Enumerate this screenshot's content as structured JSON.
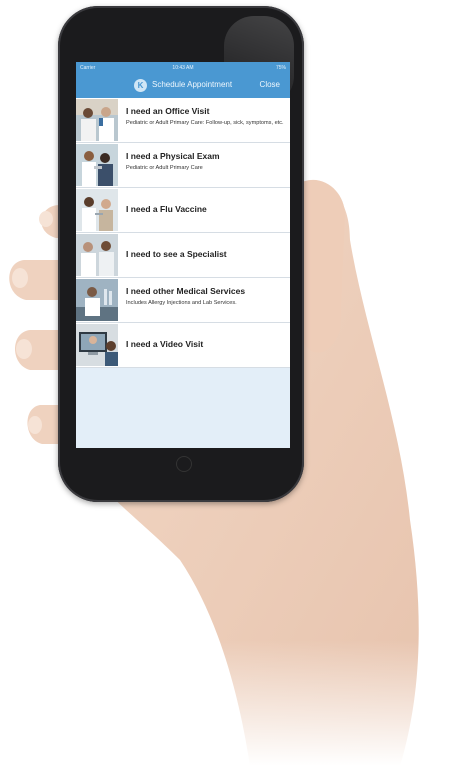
{
  "status_bar": {
    "carrier": "Carrier",
    "time": "10:43 AM",
    "battery": "75%"
  },
  "nav": {
    "title": "Schedule Appointment",
    "close_label": "Close",
    "logo_letter": "K"
  },
  "options": [
    {
      "title": "I need an Office Visit",
      "subtitle": "Pediatric or Adult Primary Care: Follow-up, sick, symptoms, etc."
    },
    {
      "title": "I need a Physical Exam",
      "subtitle": "Pediatric or Adult Primary Care"
    },
    {
      "title": "I need a Flu Vaccine",
      "subtitle": ""
    },
    {
      "title": "I need to see a Specialist",
      "subtitle": ""
    },
    {
      "title": "I need other Medical Services",
      "subtitle": "Includes Allergy Injections and Lab Services."
    },
    {
      "title": "I need a Video Visit",
      "subtitle": ""
    }
  ],
  "colors": {
    "accent": "#4a98d2",
    "screen_bg": "#e3eef8"
  }
}
